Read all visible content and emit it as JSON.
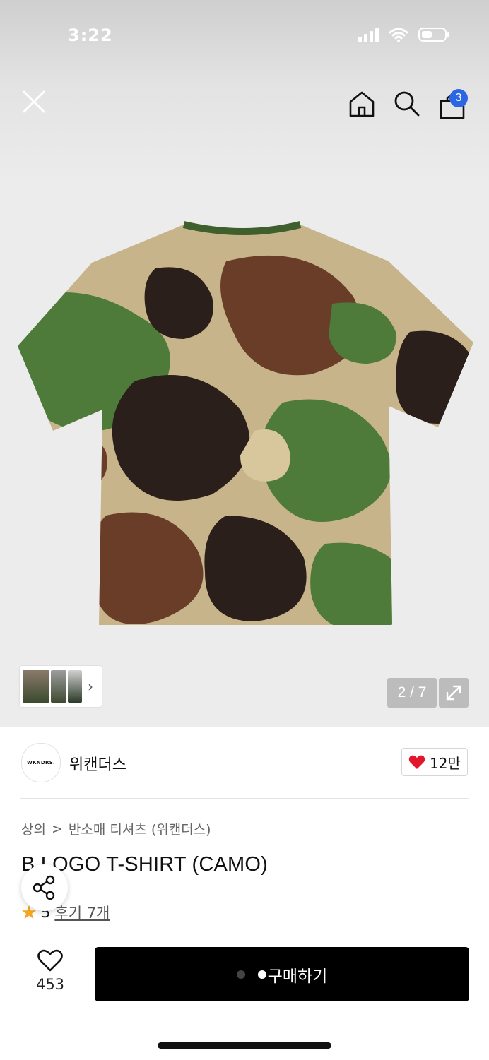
{
  "status_bar": {
    "time": "3:22"
  },
  "header": {
    "cart_count": "3"
  },
  "gallery": {
    "counter": "2 / 7",
    "thumb_chevron": "›"
  },
  "brand": {
    "logo_text": "WKNDRS.",
    "name": "위캔더스",
    "likes": "12만"
  },
  "breadcrumb": {
    "category": "상의",
    "separator": ">",
    "subcategory": "반소매 티셔츠 (위캔더스)"
  },
  "product": {
    "title": "B LOGO T-SHIRT (CAMO)",
    "rating": "5",
    "review_link": "후기 7개"
  },
  "bottom_bar": {
    "wish_count": "453",
    "buy_label": "구매하기"
  },
  "colors": {
    "buy_button": "#000000",
    "badge": "#2c66e3",
    "heart": "#e3162b",
    "star": "#f5a623"
  }
}
